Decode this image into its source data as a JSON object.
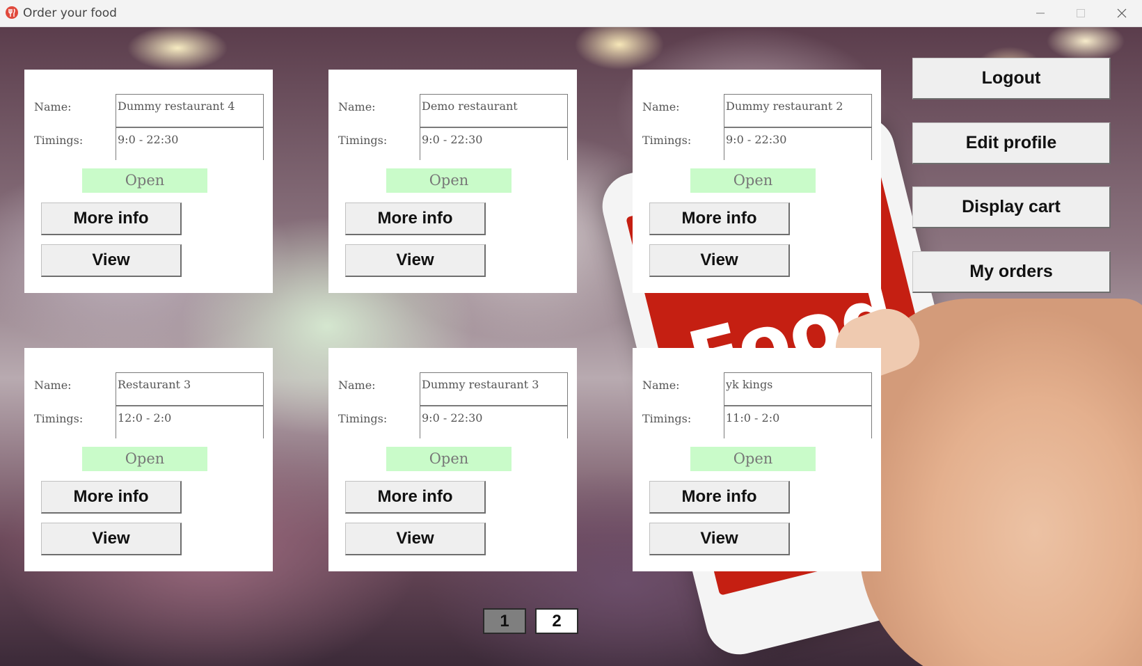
{
  "window": {
    "title": "Order your food",
    "controls": [
      "minimize-icon",
      "maximize-icon",
      "close-icon"
    ]
  },
  "labels": {
    "name": "Name:",
    "timings": "Timings:",
    "status": "Open",
    "more_info": "More info",
    "view": "View"
  },
  "restaurants": [
    {
      "name": "Dummy restaurant 4",
      "timings": "9:0 - 22:30",
      "status": "Open"
    },
    {
      "name": "Demo restaurant",
      "timings": "9:0 - 22:30",
      "status": "Open"
    },
    {
      "name": "Dummy restaurant 2",
      "timings": "9:0 - 22:30",
      "status": "Open"
    },
    {
      "name": "Restaurant 3",
      "timings": "12:0 - 2:0",
      "status": "Open"
    },
    {
      "name": "Dummy restaurant 3",
      "timings": "9:0 - 22:30",
      "status": "Open"
    },
    {
      "name": "yk kings",
      "timings": "11:0 - 2:0",
      "status": "Open"
    }
  ],
  "side_menu": {
    "logout": "Logout",
    "edit_profile": "Edit profile",
    "display_cart": "Display cart",
    "my_orders": "My orders"
  },
  "pagination": {
    "pages": [
      "1",
      "2"
    ],
    "current": "1"
  },
  "background": {
    "phone_text": "Food"
  },
  "colors": {
    "status_open_bg": "#c9fbc9",
    "phone_red": "#c51f12",
    "current_page_bg": "#7f7f7f"
  }
}
